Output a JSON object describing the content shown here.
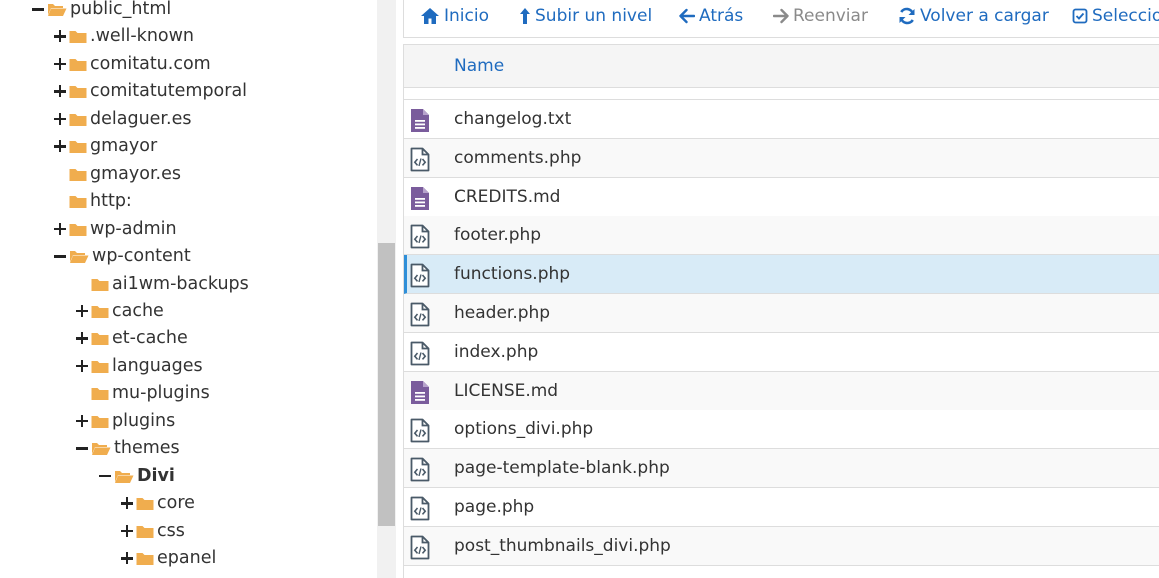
{
  "tree": {
    "items": [
      {
        "label": "public_html",
        "toggle": "minus",
        "open": true,
        "bold": false
      },
      {
        "label": ".well-known",
        "toggle": "plus",
        "open": false,
        "bold": false
      },
      {
        "label": "comitatu.com",
        "toggle": "plus",
        "open": false,
        "bold": false
      },
      {
        "label": "comitatutemporal",
        "toggle": "plus",
        "open": false,
        "bold": false
      },
      {
        "label": "delaguer.es",
        "toggle": "plus",
        "open": false,
        "bold": false
      },
      {
        "label": "gmayor",
        "toggle": "plus",
        "open": false,
        "bold": false
      },
      {
        "label": "gmayor.es",
        "toggle": "none",
        "open": false,
        "bold": false
      },
      {
        "label": "http:",
        "toggle": "none",
        "open": false,
        "bold": false
      },
      {
        "label": "wp-admin",
        "toggle": "plus",
        "open": false,
        "bold": false
      },
      {
        "label": "wp-content",
        "toggle": "minus",
        "open": true,
        "bold": false
      },
      {
        "label": "ai1wm-backups",
        "toggle": "none",
        "open": false,
        "bold": false
      },
      {
        "label": "cache",
        "toggle": "plus",
        "open": false,
        "bold": false
      },
      {
        "label": "et-cache",
        "toggle": "plus",
        "open": false,
        "bold": false
      },
      {
        "label": "languages",
        "toggle": "plus",
        "open": false,
        "bold": false
      },
      {
        "label": "mu-plugins",
        "toggle": "none",
        "open": false,
        "bold": false
      },
      {
        "label": "plugins",
        "toggle": "plus",
        "open": false,
        "bold": false
      },
      {
        "label": "themes",
        "toggle": "minus",
        "open": true,
        "bold": false
      },
      {
        "label": "Divi",
        "toggle": "minus",
        "open": true,
        "bold": true
      },
      {
        "label": "core",
        "toggle": "plus",
        "open": false,
        "bold": false
      },
      {
        "label": "css",
        "toggle": "plus",
        "open": false,
        "bold": false
      },
      {
        "label": "epanel",
        "toggle": "plus",
        "open": false,
        "bold": false
      }
    ]
  },
  "toolbar": {
    "buttons": [
      {
        "label": "Inicio",
        "icon": "home-icon",
        "disabled": false
      },
      {
        "label": "Subir un nivel",
        "icon": "level-up-icon",
        "disabled": false
      },
      {
        "label": "Atrás",
        "icon": "arrow-left-icon",
        "disabled": false
      },
      {
        "label": "Reenviar",
        "icon": "arrow-right-icon",
        "disabled": true
      },
      {
        "label": "Volver a cargar",
        "icon": "refresh-icon",
        "disabled": false
      },
      {
        "label": "Seleccionar todo",
        "icon": "checkbox-icon",
        "disabled": false
      }
    ]
  },
  "filelist": {
    "header": {
      "name": "Name"
    },
    "files": [
      {
        "name": "changelog.txt",
        "type": "text",
        "selected": false
      },
      {
        "name": "comments.php",
        "type": "code",
        "selected": false
      },
      {
        "name": "CREDITS.md",
        "type": "text",
        "selected": false
      },
      {
        "name": "footer.php",
        "type": "code",
        "selected": false
      },
      {
        "name": "functions.php",
        "type": "code",
        "selected": true
      },
      {
        "name": "header.php",
        "type": "code",
        "selected": false
      },
      {
        "name": "index.php",
        "type": "code",
        "selected": false
      },
      {
        "name": "LICENSE.md",
        "type": "text",
        "selected": false
      },
      {
        "name": "options_divi.php",
        "type": "code",
        "selected": false
      },
      {
        "name": "page-template-blank.php",
        "type": "code",
        "selected": false
      },
      {
        "name": "page.php",
        "type": "code",
        "selected": false
      },
      {
        "name": "post_thumbnails_divi.php",
        "type": "code",
        "selected": false
      }
    ]
  },
  "colors": {
    "folder": "#f0ad4e",
    "link": "#1f6bbf",
    "text_file_icon": "#7a5c9c",
    "selected_row": "#d8ebf7"
  }
}
